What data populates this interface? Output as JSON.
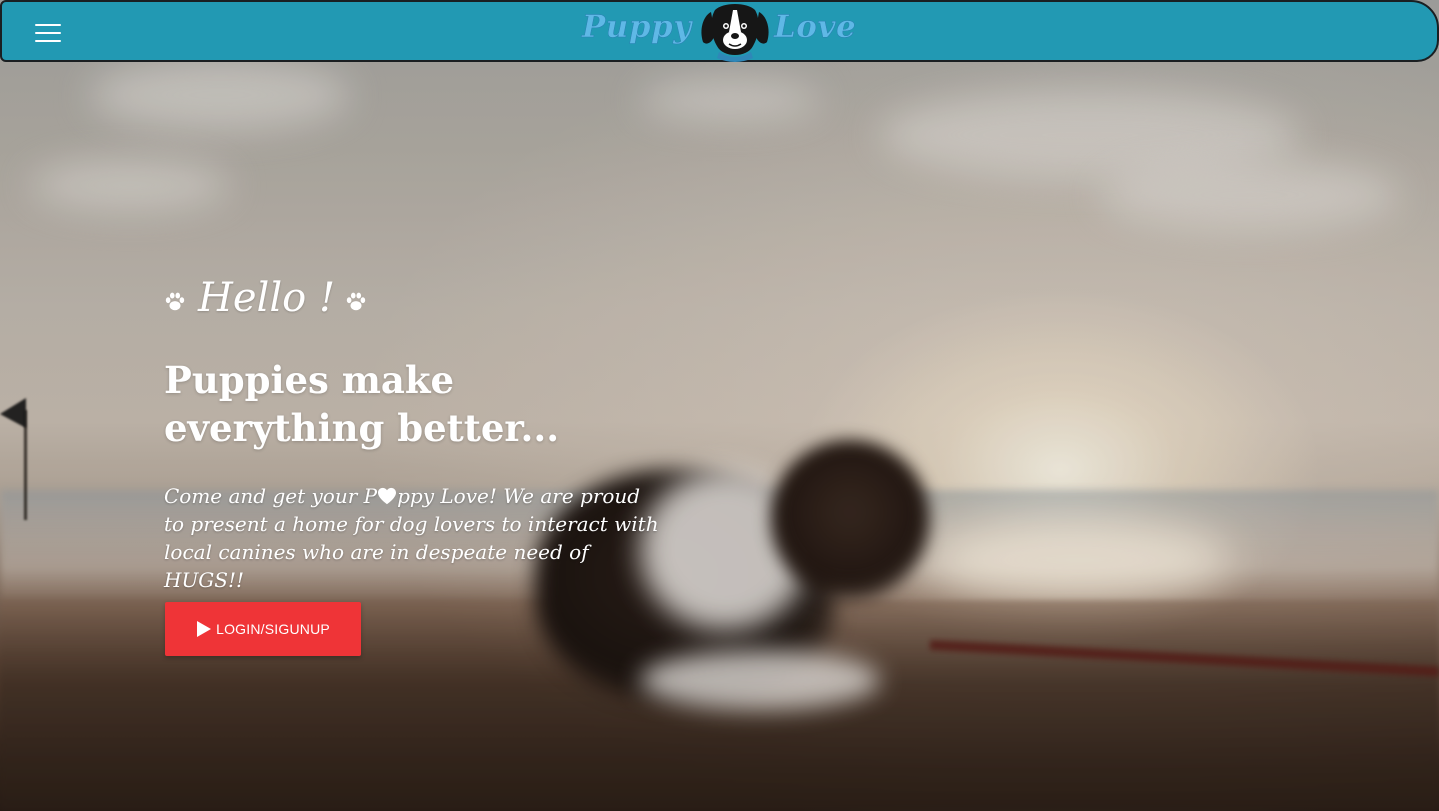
{
  "navbar": {
    "brand_left": "Puppy",
    "brand_right": "Love",
    "menu_icon": "hamburger-menu-icon",
    "logo_icon": "dog-head-icon",
    "background_color": "#2299b3",
    "brand_color": "#5fb8e6"
  },
  "hero": {
    "greeting": "Hello !",
    "greeting_icons": [
      "paw-icon",
      "paw-icon"
    ],
    "headline": "Puppies make everything better...",
    "tagline": {
      "part1": "Come and get your P",
      "heart_icon": "heart-icon",
      "part2": "ppy Love! We are proud to present a home for dog lovers to interact with local canines who are in despeate need of HUGS!!"
    },
    "cta": {
      "label": "LOGIN/SIGUNUP",
      "icon": "play-icon",
      "color": "#ef3437"
    }
  }
}
